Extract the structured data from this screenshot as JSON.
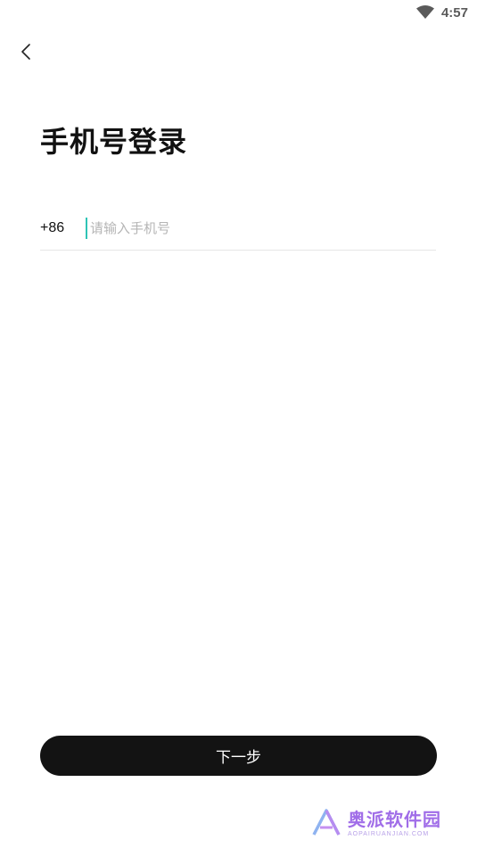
{
  "status_bar": {
    "time": "4:57",
    "wifi_icon": "wifi-icon"
  },
  "header": {
    "back_icon": "chevron-left-icon"
  },
  "main": {
    "title": "手机号登录",
    "country_code": "+86",
    "phone_placeholder": "请输入手机号",
    "phone_value": ""
  },
  "footer": {
    "next_label": "下一步"
  },
  "watermark": {
    "name": "奥派软件园",
    "url": "AOPAIRUANJIAN.COM"
  },
  "colors": {
    "button_bg": "#131313",
    "cursor": "#2ec4b6",
    "placeholder": "#b5b5b5",
    "divider": "#e6e6e6"
  }
}
